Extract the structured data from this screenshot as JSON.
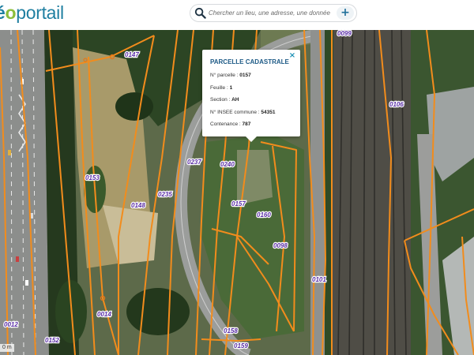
{
  "header": {
    "logo_part1": "é",
    "logo_part2": "o",
    "logo_part3": "portail"
  },
  "search": {
    "placeholder": "Chercher un lieu, une adresse, une donnée",
    "add_label": "+"
  },
  "map": {
    "scale_label": "0 m",
    "parcel_labels": [
      "0147",
      "0099",
      "0106",
      "0153",
      "0237",
      "0240",
      "0235",
      "0148",
      "0157",
      "0160",
      "0098",
      "0101",
      "0014",
      "0012",
      "0152",
      "0158",
      "0159"
    ]
  },
  "popup": {
    "title": "PARCELLE CADASTRALE",
    "close_label": "×",
    "rows": [
      {
        "label": "N° parcelle :",
        "value": "0157"
      },
      {
        "label": "Feuille :",
        "value": "1"
      },
      {
        "label": "Section :",
        "value": "AH"
      },
      {
        "label": "N° INSEE commune :",
        "value": "54351"
      },
      {
        "label": "Contenance :",
        "value": "787"
      }
    ]
  },
  "colors": {
    "parcel_line": "#f28c1c",
    "label_text": "#5a2ea6",
    "popup_title": "#1d5a86",
    "accent": "#1f7fa1"
  }
}
